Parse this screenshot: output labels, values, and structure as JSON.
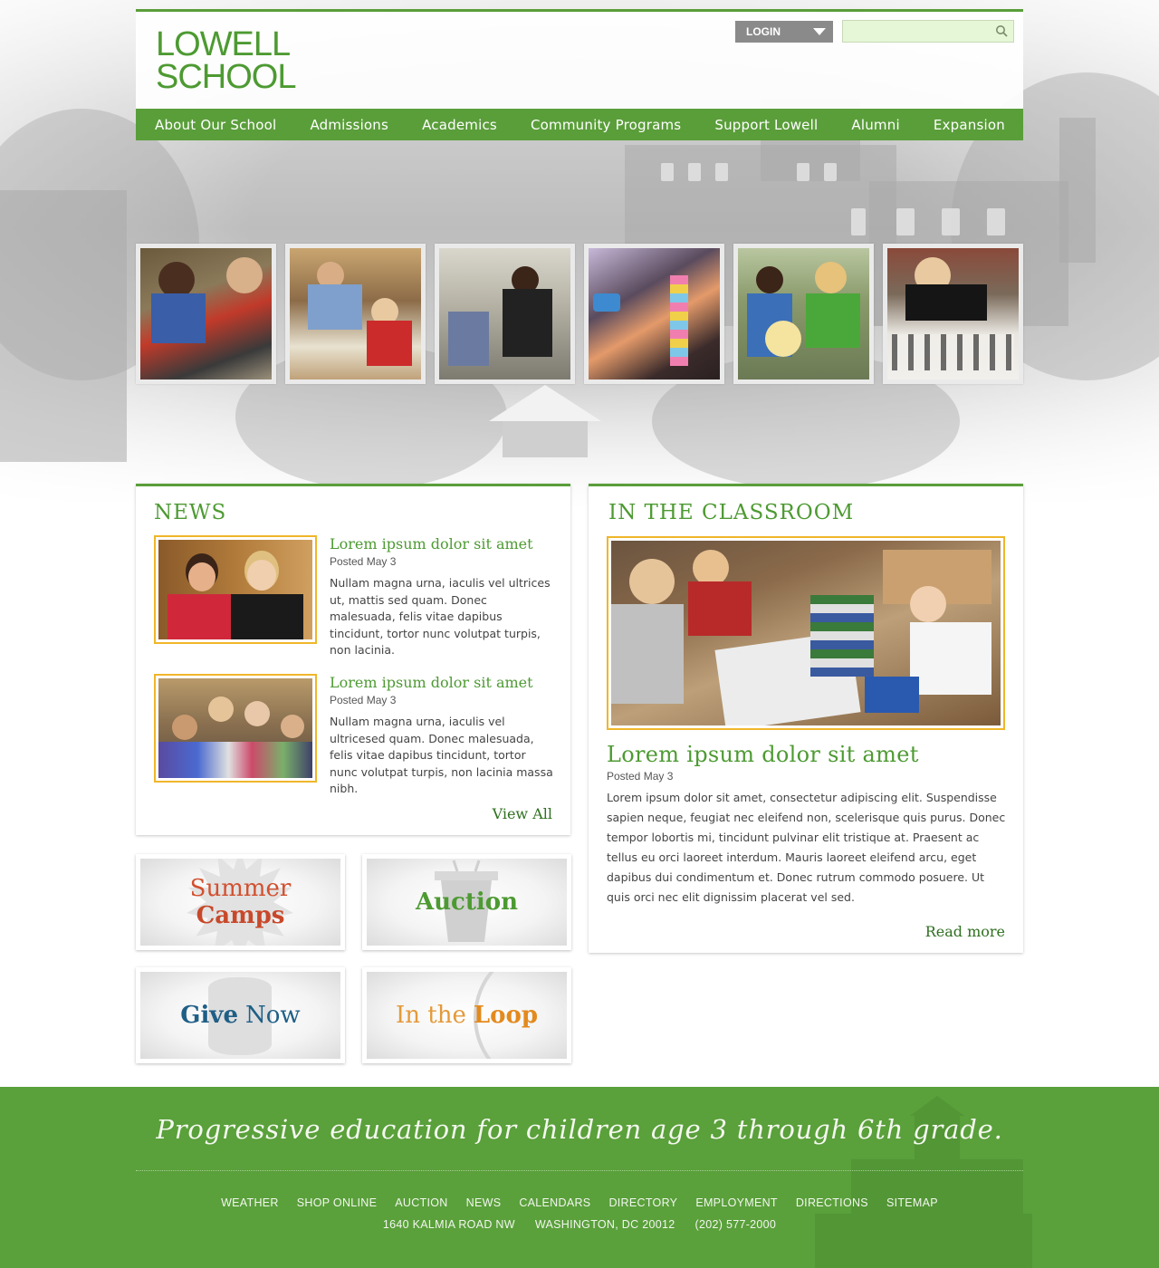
{
  "brand": {
    "line1": "LOWELL",
    "line2": "SCHOOL",
    "green": "#5a9e3a",
    "gold": "#f0b62a"
  },
  "header": {
    "login_label": "LOGIN",
    "search_placeholder": "",
    "search_icon": "search-icon"
  },
  "nav": {
    "items": [
      {
        "label": "About Our School"
      },
      {
        "label": "Admissions"
      },
      {
        "label": "Academics"
      },
      {
        "label": "Community Programs"
      },
      {
        "label": "Support Lowell"
      },
      {
        "label": "Alumni"
      },
      {
        "label": "Expansion"
      }
    ]
  },
  "news": {
    "heading": "NEWS",
    "items": [
      {
        "title": "Lorem ipsum dolor sit amet",
        "posted": "Posted May 3",
        "body": "Nullam magna urna, iaculis vel ultrices ut, mattis sed quam. Donec malesuada, felis vitae dapibus tincidunt, tortor nunc volutpat turpis, non lacinia."
      },
      {
        "title": "Lorem ipsum dolor sit amet",
        "posted": "Posted May 3",
        "body": "Nullam magna urna, iaculis vel ultricesed quam. Donec malesuada, felis vitae dapibus tincidunt, tortor nunc volutpat turpis, non lacinia massa nibh."
      }
    ],
    "view_all": "View All"
  },
  "classroom": {
    "heading": "IN THE CLASSROOM",
    "title": "Lorem ipsum dolor sit amet",
    "posted": "Posted May 3",
    "body": "Lorem ipsum dolor sit amet, consectetur adipiscing elit. Suspendisse sapien neque, feugiat nec eleifend non, scelerisque quis purus. Donec tempor lobortis mi, tincidunt pulvinar elit tristique at. Praesent ac tellus eu orci laoreet interdum. Mauris laoreet eleifend arcu, eget dapibus dui condimentum et. Donec rutrum commodo posuere. Ut quis orci nec elit dignissim placerat vel sed.",
    "read_more": "Read more"
  },
  "promos": {
    "summer": {
      "word1": "Summer",
      "word2": "Camps"
    },
    "auction": {
      "word1": "Auction"
    },
    "give": {
      "word1": "Give",
      "word2": "Now"
    },
    "loop": {
      "word1": "In the",
      "word2": "Loop"
    }
  },
  "footer": {
    "tagline": "Progressive education for children age 3 through 6th grade.",
    "links": [
      "WEATHER",
      "SHOP ONLINE",
      "AUCTION",
      "NEWS",
      "CALENDARS",
      "DIRECTORY",
      "EMPLOYMENT",
      "DIRECTIONS",
      "SITEMAP"
    ],
    "address": "1640 KALMIA ROAD NW",
    "city": "WASHINGTON, DC 20012",
    "phone": "(202) 577-2000"
  }
}
